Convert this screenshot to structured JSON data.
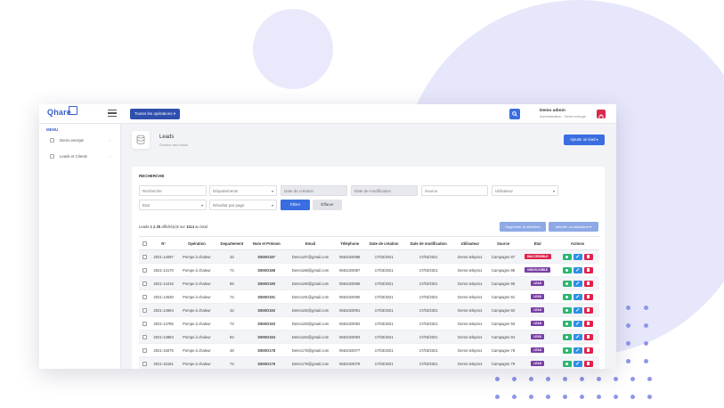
{
  "colors": {
    "primary": "#3a6ee0",
    "dark_primary": "#2f4fae",
    "danger": "#e0224b",
    "success": "#2bb673",
    "lead": "#7a3fa6",
    "inaccessible": "#d8294b"
  },
  "topbar": {
    "logo": "Qhare",
    "operations_label": "Toutes les opérations",
    "user_name": "Demo admin",
    "user_role": "Administrateur · Demo energie"
  },
  "sidebar": {
    "menu_title": "MENU",
    "items": [
      {
        "label": "Demo energie"
      },
      {
        "label": "Leads et Clients"
      }
    ]
  },
  "page": {
    "title": "Leads",
    "subtitle": "Gestion des leads",
    "add_lead_label": "Ajouter un lead"
  },
  "search": {
    "section_title": "RECHERCHE",
    "recherche_placeholder": "Recherche",
    "departements": "Départements",
    "date_creation": "Date de création",
    "date_modification": "Date de modification",
    "source_placeholder": "Source",
    "utilisateur": "Utilisateur",
    "etat": "Etat",
    "resultats": "Résultat par page",
    "filter_label": "Filtrer",
    "clear_label": "Effacer"
  },
  "list": {
    "summary_prefix": "Leads",
    "summary_range": "1 à 25",
    "summary_mid": "affiché(e)s sur",
    "summary_total": "1114",
    "summary_suffix": "au total",
    "delete_selection": "Supprimer la sélection",
    "assign_user": "Affecter un utilisateur"
  },
  "table": {
    "headers": [
      "N°",
      "Opération",
      "Departement",
      "Nom et Prénom",
      "Email",
      "Téléphone",
      "Date de création",
      "Date de modification",
      "Utilisateur",
      "Source",
      "Etat",
      "Actions"
    ],
    "rows": [
      {
        "num": "2021-14097",
        "op": "Pompe à chaleur",
        "dep": "33",
        "name": "DEMO187",
        "email": "Demo187@gmail.com",
        "tel": "0661020088",
        "created": "17/03/2021",
        "modified": "17/03/2021",
        "user": "Demo telepro1",
        "source": "Campagne 87",
        "state": "INACCESSIBLE",
        "state_type": "red"
      },
      {
        "num": "2021-14170",
        "op": "Pompe à chaleur",
        "dep": "74",
        "name": "DEMO188",
        "email": "Demo188@gmail.com",
        "tel": "0661020087",
        "created": "17/03/2021",
        "modified": "17/03/2021",
        "user": "Demo telepro1",
        "source": "Campagne 88",
        "state": "NON ELIGIBLE",
        "state_type": "purple"
      },
      {
        "num": "2021-14415",
        "op": "Pompe à chaleur",
        "dep": "69",
        "name": "DEMO190",
        "email": "Demo190@gmail.com",
        "tel": "0661020089",
        "created": "17/03/2021",
        "modified": "17/03/2021",
        "user": "Demo telepro1",
        "source": "Campagne 90",
        "state": "LEAD",
        "state_type": "purple"
      },
      {
        "num": "2021-14530",
        "op": "Pompe à chaleur",
        "dep": "74",
        "name": "DEMO191",
        "email": "Demo191@gmail.com",
        "tel": "0661020090",
        "created": "17/03/2021",
        "modified": "17/03/2021",
        "user": "Demo telepro1",
        "source": "Campagne 91",
        "state": "LEAD",
        "state_type": "purple"
      },
      {
        "num": "2021-14684",
        "op": "Pompe à chaleur",
        "dep": "42",
        "name": "DEMO192",
        "email": "Demo192@gmail.com",
        "tel": "0661020091",
        "created": "17/03/2021",
        "modified": "17/03/2021",
        "user": "Demo telepro1",
        "source": "Campagne 92",
        "state": "LEAD",
        "state_type": "purple"
      },
      {
        "num": "2021-14785",
        "op": "Pompe à chaleur",
        "dep": "73",
        "name": "DEMO193",
        "email": "Demo193@gmail.com",
        "tel": "0661020092",
        "created": "17/03/2021",
        "modified": "17/03/2021",
        "user": "Demo telepro1",
        "source": "Campagne 93",
        "state": "LEAD",
        "state_type": "purple"
      },
      {
        "num": "2021-14884",
        "op": "Pompe à chaleur",
        "dep": "92",
        "name": "DEMO194",
        "email": "Demo194@gmail.com",
        "tel": "0661020093",
        "created": "17/03/2021",
        "modified": "17/03/2021",
        "user": "Demo telepro1",
        "source": "Campagne 94",
        "state": "LEAD",
        "state_type": "purple"
      },
      {
        "num": "2021-15075",
        "op": "Pompe à chaleur",
        "dep": "48",
        "name": "DEMO178",
        "email": "Demo178@gmail.com",
        "tel": "0661020077",
        "created": "17/03/2021",
        "modified": "17/03/2021",
        "user": "Demo telepro1",
        "source": "Campagne 78",
        "state": "LEAD",
        "state_type": "purple"
      },
      {
        "num": "2021-15181",
        "op": "Pompe à chaleur",
        "dep": "74",
        "name": "DEMO179",
        "email": "Demo179@gmail.com",
        "tel": "0661020078",
        "created": "17/03/2021",
        "modified": "17/03/2021",
        "user": "Demo telepro1",
        "source": "Campagne 79",
        "state": "LEAD",
        "state_type": "purple"
      }
    ]
  }
}
